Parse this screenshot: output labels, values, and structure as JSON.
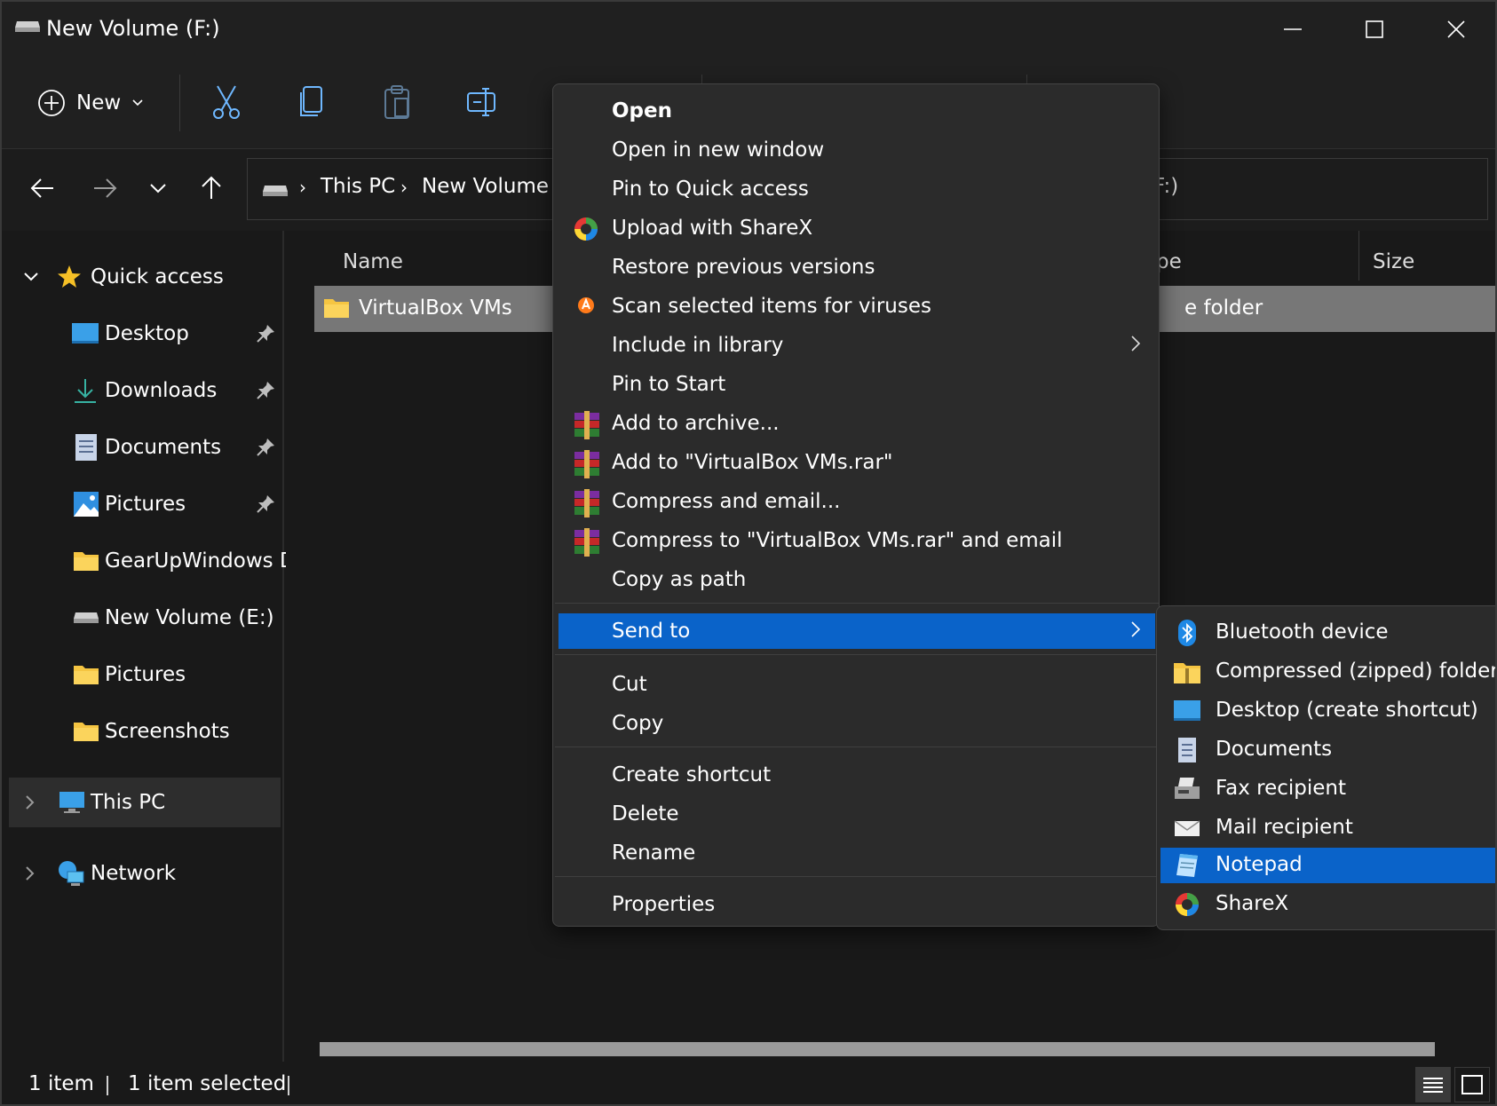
{
  "window": {
    "title": "New Volume (F:)"
  },
  "toolbar": {
    "new_label": "New"
  },
  "address": {
    "crumbs": [
      "This PC",
      "New Volume"
    ],
    "tail": "F:)"
  },
  "sidebar": {
    "quick_access": "Quick access",
    "items": [
      {
        "label": "Desktop",
        "icon": "desktop-icon",
        "pinned": true
      },
      {
        "label": "Downloads",
        "icon": "download-icon",
        "pinned": true
      },
      {
        "label": "Documents",
        "icon": "documents-icon",
        "pinned": true
      },
      {
        "label": "Pictures",
        "icon": "pictures-icon",
        "pinned": true
      },
      {
        "label": "GearUpWindows D",
        "icon": "folder-icon",
        "pinned": false
      },
      {
        "label": "New Volume (E:)",
        "icon": "drive-icon",
        "pinned": false
      },
      {
        "label": "Pictures",
        "icon": "folder-icon",
        "pinned": false
      },
      {
        "label": "Screenshots",
        "icon": "folder-icon",
        "pinned": false
      }
    ],
    "this_pc": "This PC",
    "network": "Network"
  },
  "content": {
    "columns": {
      "name": "Name",
      "type": "pe",
      "size": "Size"
    },
    "rows": [
      {
        "name": "VirtualBox VMs",
        "type": "e folder"
      }
    ]
  },
  "status": {
    "count": "1 item",
    "selected": "1 item selected"
  },
  "context_menu": {
    "items": [
      {
        "label": "Open",
        "bold": true
      },
      {
        "label": "Open in new window"
      },
      {
        "label": "Pin to Quick access"
      },
      {
        "label": "Upload with ShareX",
        "icon": "sharex-icon"
      },
      {
        "label": "Restore previous versions"
      },
      {
        "label": "Scan selected items for viruses",
        "icon": "avast-icon"
      },
      {
        "label": "Include in library",
        "submenu": true
      },
      {
        "label": "Pin to Start"
      },
      {
        "label": "Add to archive...",
        "icon": "winrar-icon"
      },
      {
        "label": "Add to \"VirtualBox VMs.rar\"",
        "icon": "winrar-icon"
      },
      {
        "label": "Compress and email...",
        "icon": "winrar-icon"
      },
      {
        "label": "Compress to \"VirtualBox VMs.rar\" and email",
        "icon": "winrar-icon"
      },
      {
        "label": "Copy as path"
      }
    ],
    "send_to": "Send to",
    "edit_items": [
      {
        "label": "Cut"
      },
      {
        "label": "Copy"
      }
    ],
    "file_items": [
      {
        "label": "Create shortcut"
      },
      {
        "label": "Delete"
      },
      {
        "label": "Rename"
      }
    ],
    "properties": "Properties"
  },
  "send_to_menu": {
    "items": [
      {
        "label": "Bluetooth device",
        "icon": "bluetooth-icon"
      },
      {
        "label": "Compressed (zipped) folder",
        "icon": "zip-folder-icon"
      },
      {
        "label": "Desktop (create shortcut)",
        "icon": "desktop-icon"
      },
      {
        "label": "Documents",
        "icon": "documents-icon"
      },
      {
        "label": "Fax recipient",
        "icon": "fax-icon"
      },
      {
        "label": "Mail recipient",
        "icon": "mail-icon"
      },
      {
        "label": "Notepad",
        "icon": "notepad-icon",
        "highlighted": true
      },
      {
        "label": "ShareX",
        "icon": "sharex-icon"
      }
    ]
  },
  "colors": {
    "accent": "#0a63c9",
    "folder": "#f5c542",
    "background": "#191919",
    "menu": "#2b2b2b"
  }
}
